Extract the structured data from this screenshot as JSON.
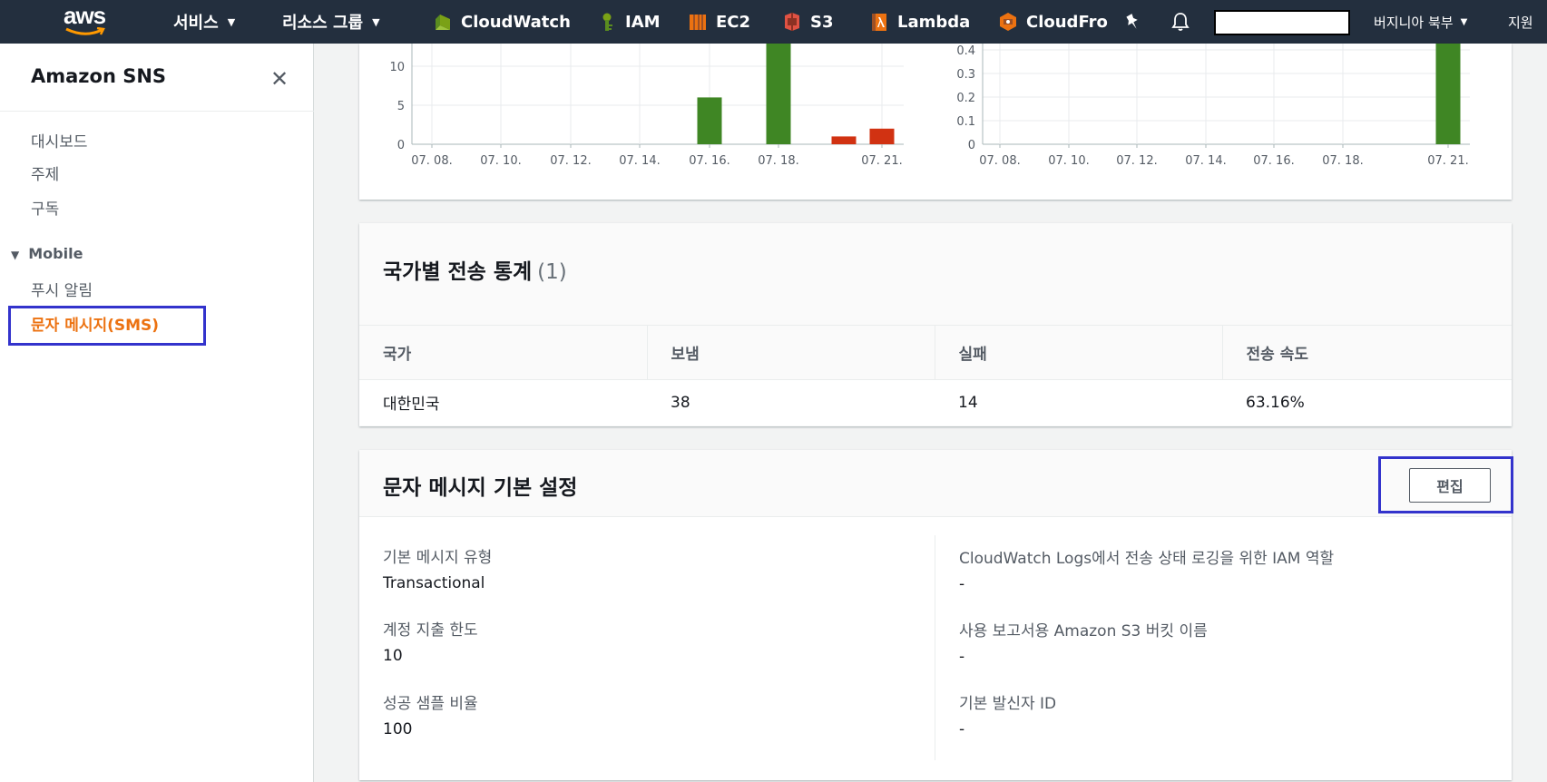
{
  "topnav": {
    "logo_text": "aws",
    "services_label": "서비스",
    "resource_groups_label": "리소스 그룹",
    "shortcuts": [
      {
        "label": "CloudWatch",
        "icon": "cloudwatch-icon",
        "color": "#7aa116"
      },
      {
        "label": "IAM",
        "icon": "iam-icon",
        "color": "#7aa116"
      },
      {
        "label": "EC2",
        "icon": "ec2-icon",
        "color": "#ec7211"
      },
      {
        "label": "S3",
        "icon": "s3-icon",
        "color": "#e05243"
      },
      {
        "label": "Lambda",
        "icon": "lambda-icon",
        "color": "#ec7211"
      },
      {
        "label": "CloudFro",
        "icon": "cloudfront-icon",
        "color": "#ec7211"
      }
    ],
    "region_label": "버지니아 북부",
    "support_label": "지원"
  },
  "sidebar": {
    "title": "Amazon SNS",
    "items": [
      "대시보드",
      "주제",
      "구독"
    ],
    "section_label": "Mobile",
    "section_items": [
      "푸시 알림",
      "문자 메시지(SMS)"
    ],
    "active_item": "문자 메시지(SMS)"
  },
  "colors": {
    "accent": "#ec7211",
    "success_bar": "#3f8624",
    "failure_bar": "#d13212",
    "highlight_box": "#3333cc"
  },
  "chart_data": [
    {
      "type": "bar",
      "x_ticks": [
        "07. 08.",
        "07. 10.",
        "07. 12.",
        "07. 14.",
        "07. 16.",
        "07. 18.",
        "07. 21."
      ],
      "y_ticks": [
        "0",
        "5",
        "10"
      ],
      "ylim": [
        0,
        10
      ],
      "series": [
        {
          "color": "#3f8624",
          "points": [
            {
              "x": "07. 16.",
              "y": 6
            },
            {
              "x": "07. 18.",
              "y": 14
            }
          ]
        },
        {
          "color": "#d13212",
          "points": [
            {
              "x": "07. 20.",
              "y": 1
            },
            {
              "x": "07. 21.",
              "y": 2
            }
          ]
        }
      ]
    },
    {
      "type": "bar",
      "x_ticks": [
        "07. 08.",
        "07. 10.",
        "07. 12.",
        "07. 14.",
        "07. 16.",
        "07. 18.",
        "07. 21."
      ],
      "y_ticks": [
        "0",
        "0.1",
        "0.2",
        "0.3",
        "0.4"
      ],
      "ylim": [
        0,
        0.4
      ],
      "series": [
        {
          "color": "#3f8624",
          "points": [
            {
              "x": "07. 21.",
              "y": 0.8
            }
          ]
        }
      ]
    }
  ],
  "country_stats": {
    "title": "국가별 전송 통계",
    "count": "(1)",
    "columns": [
      "국가",
      "보냄",
      "실패",
      "전송 속도"
    ],
    "rows": [
      [
        "대한민국",
        "38",
        "14",
        "63.16%"
      ]
    ]
  },
  "sms_settings": {
    "title": "문자 메시지 기본 설정",
    "edit_label": "편집",
    "left": [
      {
        "label": "기본 메시지 유형",
        "value": "Transactional"
      },
      {
        "label": "계정 지출 한도",
        "value": "10"
      },
      {
        "label": "성공 샘플 비율",
        "value": "100"
      }
    ],
    "right": [
      {
        "label": "CloudWatch Logs에서 전송 상태 로깅을 위한 IAM 역할",
        "value": "-"
      },
      {
        "label": "사용 보고서용 Amazon S3 버킷 이름",
        "value": "-"
      },
      {
        "label": "기본 발신자 ID",
        "value": "-"
      }
    ]
  }
}
